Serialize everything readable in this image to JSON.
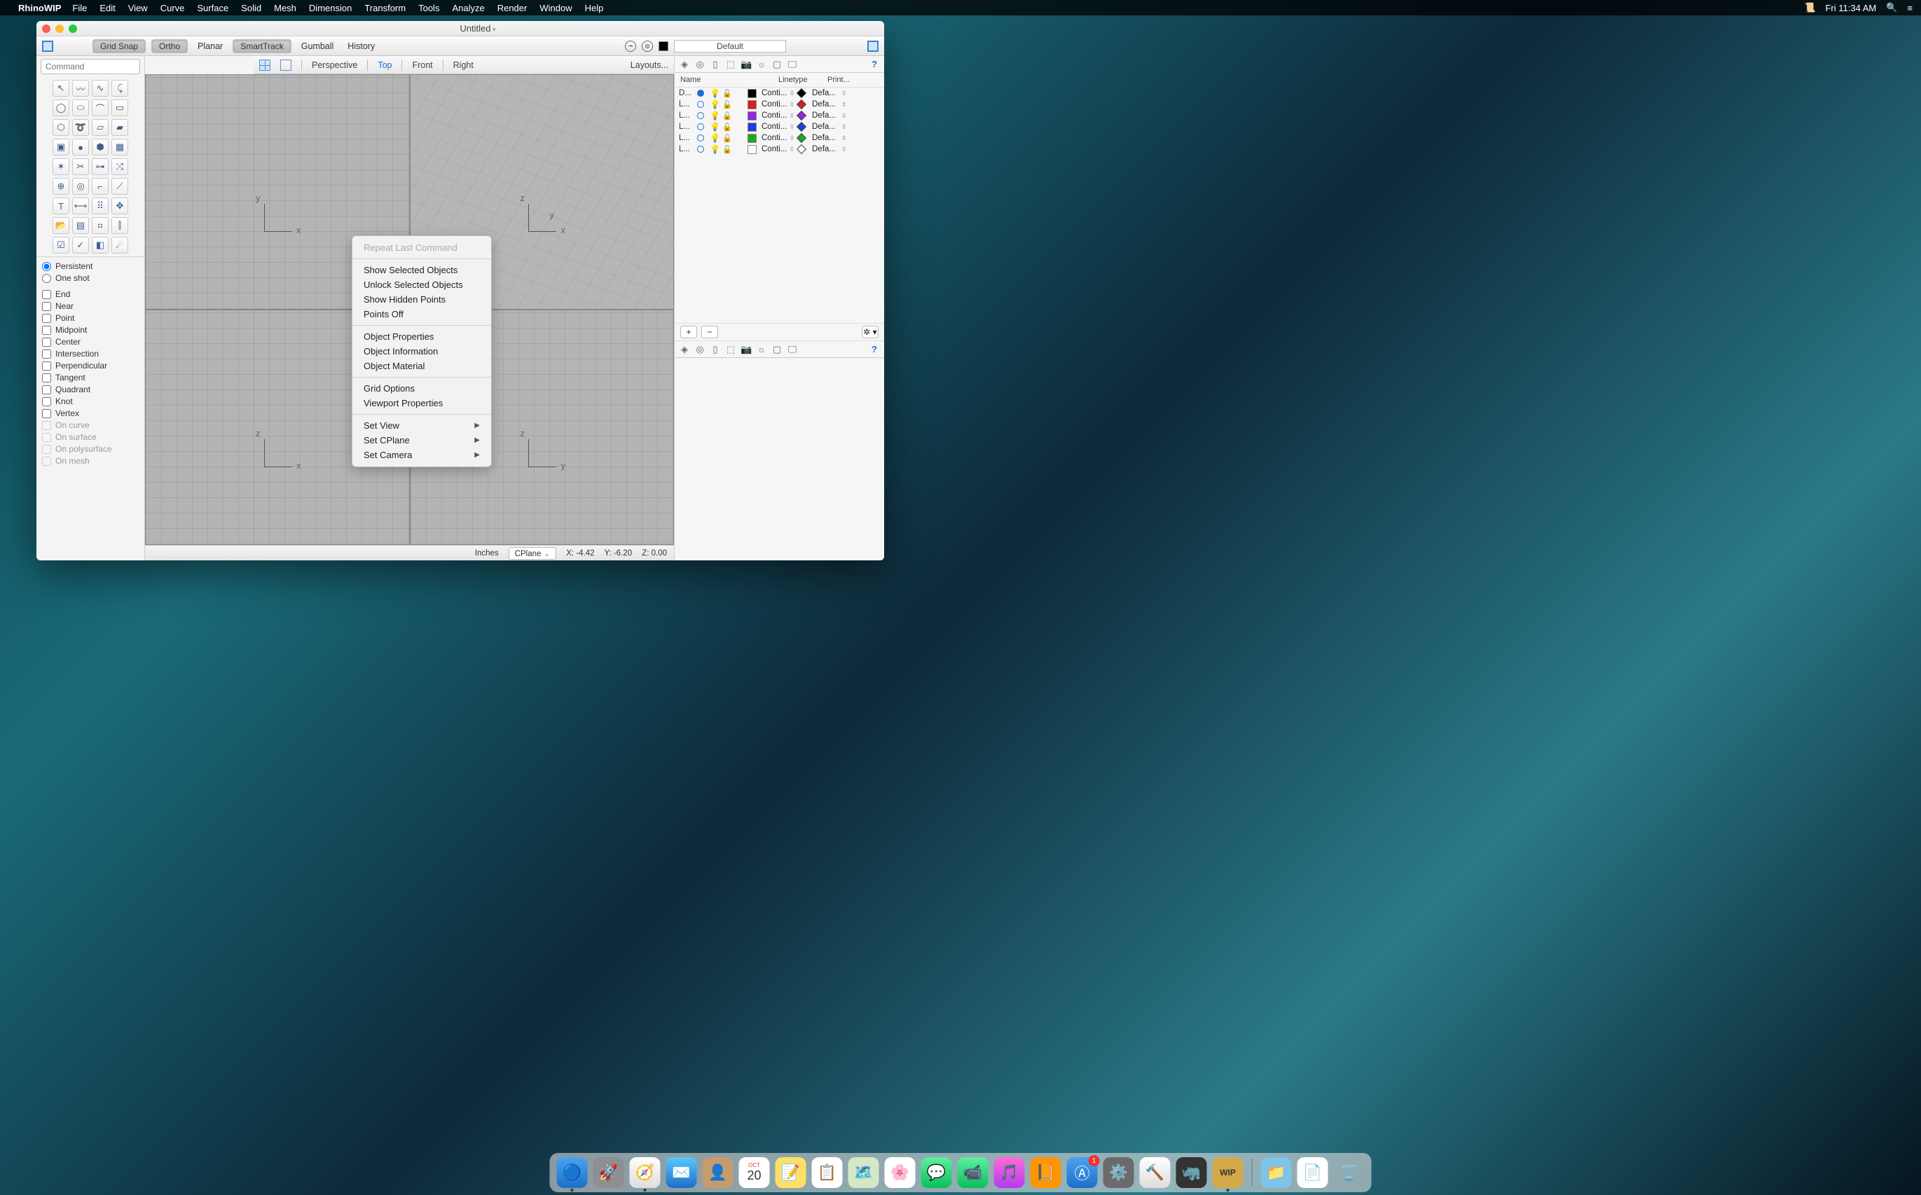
{
  "menubar": {
    "app": "RhinoWIP",
    "items": [
      "File",
      "Edit",
      "View",
      "Curve",
      "Surface",
      "Solid",
      "Mesh",
      "Dimension",
      "Transform",
      "Tools",
      "Analyze",
      "Render",
      "Window",
      "Help"
    ],
    "clock": "Fri 11:34 AM"
  },
  "window": {
    "title": "Untitled"
  },
  "topbar": {
    "grid_snap": "Grid Snap",
    "ortho": "Ortho",
    "planar": "Planar",
    "smarttrack": "SmartTrack",
    "gumball": "Gumball",
    "history": "History",
    "layer_default": "Default"
  },
  "vptabs": {
    "perspective": "Perspective",
    "top": "Top",
    "front": "Front",
    "right": "Right",
    "layouts": "Layouts..."
  },
  "command": {
    "placeholder": "Command"
  },
  "osnap": {
    "mode_persistent": "Persistent",
    "mode_oneshot": "One shot",
    "snaps": [
      "End",
      "Near",
      "Point",
      "Midpoint",
      "Center",
      "Intersection",
      "Perpendicular",
      "Tangent",
      "Quadrant",
      "Knot",
      "Vertex"
    ],
    "snaps_dim": [
      "On curve",
      "On surface",
      "On polysurface",
      "On mesh"
    ]
  },
  "viewports": {
    "tl": {
      "ax1": "y",
      "ax2": "x"
    },
    "tr": {
      "ax1": "z",
      "ax2": "x",
      "ax3": "y"
    },
    "bl": {
      "ax1": "z",
      "ax2": "x"
    },
    "br": {
      "ax1": "z",
      "ax2": "y"
    }
  },
  "context_menu": {
    "repeat": "Repeat Last Command",
    "g1": [
      "Show Selected Objects",
      "Unlock Selected Objects",
      "Show Hidden Points",
      "Points Off"
    ],
    "g2": [
      "Object Properties",
      "Object Information",
      "Object Material"
    ],
    "g3": [
      "Grid Options",
      "Viewport Properties"
    ],
    "g4": [
      "Set View",
      "Set CPlane",
      "Set Camera"
    ]
  },
  "layers": {
    "head_name": "Name",
    "head_linetype": "Linetype",
    "head_print": "Print...",
    "rows": [
      {
        "name": "D...",
        "current": true,
        "color": "#000000",
        "diamond": "#000000",
        "lt": "Conti...",
        "pw": "Defa..."
      },
      {
        "name": "L...",
        "current": false,
        "color": "#d81e1e",
        "diamond": "#d81e1e",
        "lt": "Conti...",
        "pw": "Defa..."
      },
      {
        "name": "L...",
        "current": false,
        "color": "#8a2be2",
        "diamond": "#8a2be2",
        "lt": "Conti...",
        "pw": "Defa..."
      },
      {
        "name": "L...",
        "current": false,
        "color": "#1e3ed8",
        "diamond": "#1e3ed8",
        "lt": "Conti...",
        "pw": "Defa..."
      },
      {
        "name": "L...",
        "current": false,
        "color": "#1ea81e",
        "diamond": "#1ea81e",
        "lt": "Conti...",
        "pw": "Defa..."
      },
      {
        "name": "L...",
        "current": false,
        "color": "#ffffff",
        "diamond": "#ffffff",
        "lt": "Conti...",
        "pw": "Defa..."
      }
    ]
  },
  "status": {
    "units": "Inches",
    "cplane": "CPlane",
    "x": "X: -4.42",
    "y": "Y: -6.20",
    "z": "Z: 0.00"
  },
  "dock": {
    "finder": "🔵",
    "launchpad": "🚀",
    "safari": "🧭",
    "mail": "✉️",
    "contacts": "👤",
    "calendar_month": "OCT",
    "calendar_day": "20",
    "notes": "📝",
    "reminders": "📋",
    "maps": "🗺️",
    "photos": "🌸",
    "messages": "💬",
    "facetime": "📹",
    "itunes": "🎵",
    "ibooks": "📙",
    "appstore": "Ⓐ",
    "appstore_badge": "1",
    "sysprefs": "⚙️",
    "xcode": "🔨",
    "rhino": "🦏",
    "wip": "WIP",
    "folder": "📁",
    "doc": "📄",
    "trash": "🗑️"
  }
}
